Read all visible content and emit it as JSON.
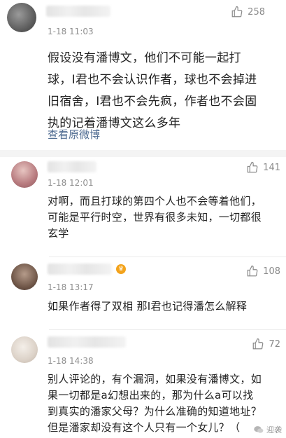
{
  "comments": [
    {
      "time": "1-18 11:03",
      "likes": "258",
      "lines": [
        "假设没有潘博文，他们不可能一起打",
        "球，I君也不会认识作者，球也不会掉进",
        "旧宿舍，I君也不会先疯，作者也不会固",
        "执的记着潘博文这么多年"
      ],
      "link": "查看原微博"
    },
    {
      "time": "1-18 12:01",
      "likes": "141",
      "lines": [
        "对啊，而且打球的第四个人也不会等着他们，",
        "可能是平行时空，世界有很多未知，一切都很",
        "玄学"
      ]
    },
    {
      "time": "1-18 13:17",
      "likes": "108",
      "lines": [
        "如果作者得了双相 那I君也记得潘怎么解释"
      ]
    },
    {
      "time": "1-18 14:38",
      "likes": "72",
      "lines": [
        "别人评论的，有个漏洞，如果没有潘博文，如",
        "果一切都是a幻想出来的，那为什么a可以找",
        "到真实的潘家父母？为什么准确的知道地址？",
        "但是潘家却没有这个人只有一个女儿？（"
      ]
    }
  ],
  "watermark": "迎袭",
  "colors": {
    "link": "#4d6a90",
    "meta": "#8f8f8f",
    "divider": "#f4f4f4"
  }
}
